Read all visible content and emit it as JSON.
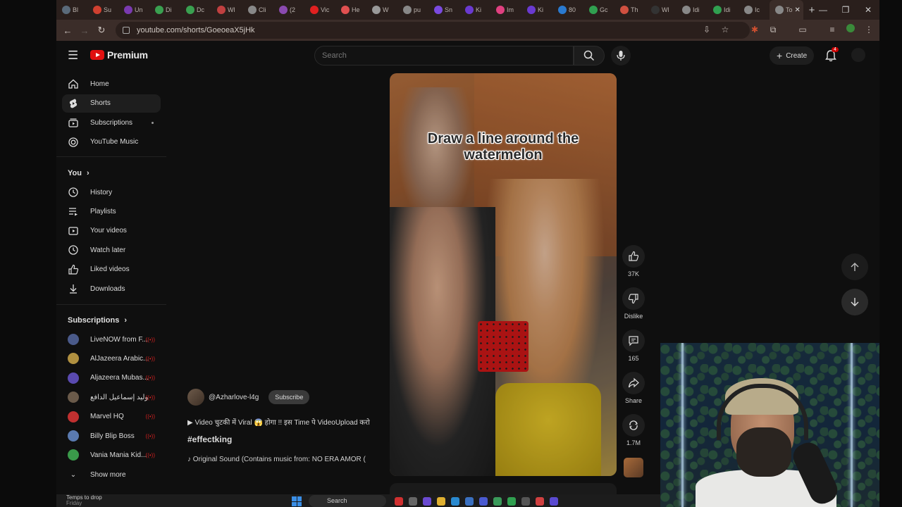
{
  "browser": {
    "tabs": [
      {
        "label": "Bl",
        "color": "#5a6a7a"
      },
      {
        "label": "Su",
        "color": "#d04030"
      },
      {
        "label": "Un",
        "color": "#7a3ab0"
      },
      {
        "label": "Di",
        "color": "#3aa050"
      },
      {
        "label": "Dc",
        "color": "#3aa050"
      },
      {
        "label": "Wl",
        "color": "#c04040"
      },
      {
        "label": "Cli",
        "color": "#888888"
      },
      {
        "label": "(2",
        "color": "#8a4ab0"
      },
      {
        "label": "Vic",
        "color": "#e02020"
      },
      {
        "label": "He",
        "color": "#e05050"
      },
      {
        "label": "W",
        "color": "#999999"
      },
      {
        "label": "pu",
        "color": "#888888"
      },
      {
        "label": "Sn",
        "color": "#7a4ae0"
      },
      {
        "label": "Ki",
        "color": "#6a3ad0"
      },
      {
        "label": "Im",
        "color": "#e04080"
      },
      {
        "label": "Ki",
        "color": "#6a3ad0"
      },
      {
        "label": "80",
        "color": "#2a7ad0"
      },
      {
        "label": "Gc",
        "color": "#30a050"
      },
      {
        "label": "Th",
        "color": "#d05040"
      },
      {
        "label": "Wl",
        "color": "#333333"
      },
      {
        "label": "Idi",
        "color": "#888888"
      },
      {
        "label": "Idi",
        "color": "#30a050"
      },
      {
        "label": "Ic",
        "color": "#888888"
      },
      {
        "label": "To",
        "color": "#888888"
      }
    ],
    "url": "youtube.com/shorts/GoeoeaX5jHk",
    "window_controls": [
      "—",
      "❐",
      "✕"
    ]
  },
  "youtube": {
    "logo_text": "Premium",
    "search_placeholder": "Search",
    "create_label": "Create",
    "notification_count": "4",
    "sidebar": {
      "main": [
        {
          "label": "Home",
          "icon": "home-icon"
        },
        {
          "label": "Shorts",
          "icon": "shorts-icon",
          "active": true
        },
        {
          "label": "Subscriptions",
          "icon": "subscriptions-icon"
        },
        {
          "label": "YouTube Music",
          "icon": "music-icon"
        }
      ],
      "you_heading": "You",
      "you": [
        {
          "label": "History",
          "icon": "history-icon"
        },
        {
          "label": "Playlists",
          "icon": "playlists-icon"
        },
        {
          "label": "Your videos",
          "icon": "your-videos-icon"
        },
        {
          "label": "Watch later",
          "icon": "watch-later-icon"
        },
        {
          "label": "Liked videos",
          "icon": "liked-icon"
        },
        {
          "label": "Downloads",
          "icon": "download-icon"
        }
      ],
      "subscriptions_heading": "Subscriptions",
      "subscriptions": [
        {
          "label": "LiveNOW from F...",
          "color": "#4a5a8a"
        },
        {
          "label": "AlJazeera Arabic...",
          "color": "#b09040"
        },
        {
          "label": "Aljazeera Mubas...",
          "color": "#5a4ab0"
        },
        {
          "label": "وليد إسماعيل الدافع",
          "color": "#6a5a4a"
        },
        {
          "label": "Marvel HQ",
          "color": "#c03030"
        },
        {
          "label": "Billy Blip Boss",
          "color": "#5a7ab0"
        },
        {
          "label": "Vania Mania Kid...",
          "color": "#3a9a4a"
        }
      ],
      "show_more": "Show more"
    },
    "short": {
      "channel": "@Azharlove-l4g",
      "subscribe_label": "Subscribe",
      "title": "▶ Video चुटकी में Viral 😱 होगा !! इस Time पे VideoUpload करो",
      "hashtag": "#effectking",
      "sound": "♪ Original Sound (Contains music from: NO ERA AMOR (",
      "overlay_caption": "Draw a line around the watermelon",
      "likes": "37K",
      "dislike_label": "Dislike",
      "comments": "165",
      "share_label": "Share",
      "remix_count": "1.7M"
    }
  },
  "taskbar": {
    "weather_line1": "Temps to drop",
    "weather_line2": "Friday",
    "search_label": "Search"
  }
}
